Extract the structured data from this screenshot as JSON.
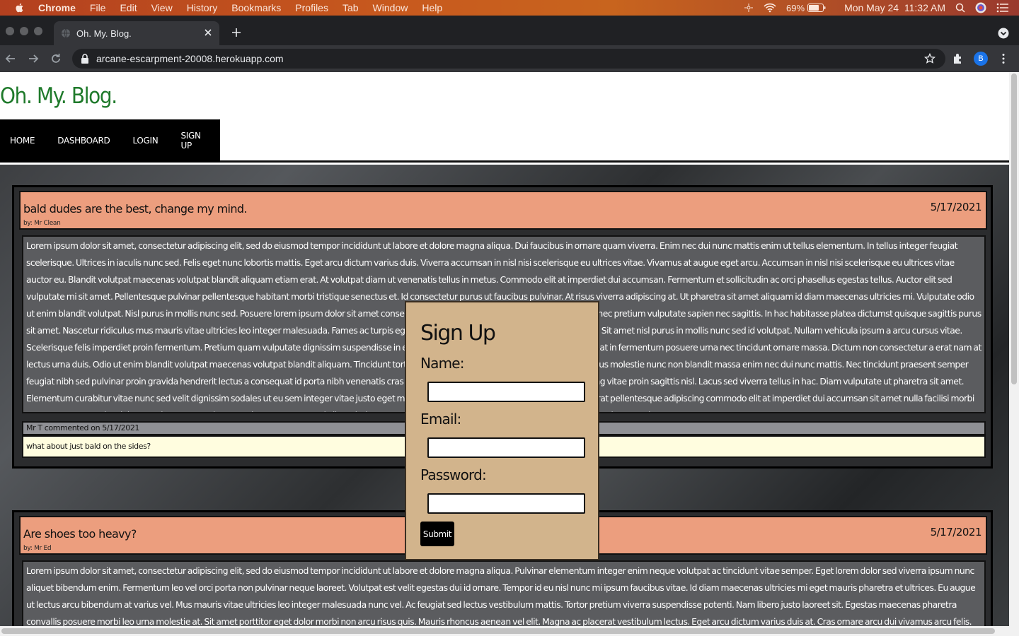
{
  "mac_menubar": {
    "app_name": "Chrome",
    "menus": [
      "File",
      "Edit",
      "View",
      "History",
      "Bookmarks",
      "Profiles",
      "Tab",
      "Window",
      "Help"
    ],
    "battery": "69%",
    "clock": "Mon May 24  11:32 AM"
  },
  "browser": {
    "tab_title": "Oh. My. Blog.",
    "url": "arcane-escarpment-20008.herokuapp.com",
    "profile_initial": "B"
  },
  "site": {
    "title": "Oh. My. Blog.",
    "nav": [
      "HOME",
      "DASHBOARD",
      "LOGIN",
      "SIGN UP"
    ]
  },
  "posts": [
    {
      "title": "bald dudes are the best, change my mind.",
      "author": "by: Mr Clean",
      "date": "5/17/2021",
      "body": "Lorem ipsum dolor sit amet, consectetur adipiscing elit, sed do eiusmod tempor incididunt ut labore et dolore magna aliqua. Dui faucibus in ornare quam viverra. Enim nec dui nunc mattis enim ut tellus elementum. In tellus integer feugiat scelerisque. Ultrices in iaculis nunc sed. Felis eget nunc lobortis mattis. Eget arcu dictum varius duis. Viverra accumsan in nisl nisi scelerisque eu ultrices vitae. Vivamus at augue eget arcu. Accumsan in nisl nisi scelerisque eu ultrices vitae auctor eu. Blandit volutpat maecenas volutpat blandit aliquam etiam erat. At volutpat diam ut venenatis tellus in metus. Commodo elit at imperdiet dui accumsan. Fermentum et sollicitudin ac orci phasellus egestas tellus. Auctor elit sed vulputate mi sit amet. Pellentesque pulvinar pellentesque habitant morbi tristique senectus et. Id consectetur purus ut faucibus pulvinar. At risus viverra adipiscing at. Ut pharetra sit amet aliquam id diam maecenas ultricies mi. Vulputate odio ut enim blandit volutpat. Nisl purus in mollis nunc sed. Posuere lorem ipsum dolor sit amet consectetur. Phasellus faucibus scelerisque eleifend donec pretium vulputate sapien nec sagittis. In hac habitasse platea dictumst quisque sagittis purus sit amet. Nascetur ridiculus mus mauris vitae ultricies leo integer malesuada. Fames ac turpis egestas integer eget aliquet nibh praesent tristique. Sit amet nisl purus in mollis nunc sed id volutpat. Nullam vehicula ipsum a arcu cursus vitae. Scelerisque felis imperdiet proin fermentum. Pretium quam vulputate dignissim suspendisse in est ante. Donec adipiscing tristique risus nec feugiat in fermentum posuere urna nec tincidunt ornare massa. Dictum non consectetur a erat nam at lectus urna duis. Odio ut enim blandit volutpat maecenas volutpat blandit aliquam. Tincidunt tortor aliquam nulla facilisi cras. Elementum nibh tellus molestie nunc non blandit massa enim nec dui nunc mattis. Nec tincidunt praesent semper feugiat nibh sed pulvinar proin gravida hendrerit lectus a consequat id porta nibh venenatis cras sed. Elementum nisi quis eleifend quam adipiscing vitae proin sagittis nisl. Lacus sed viverra tellus in hac. Diam vulputate ut pharetra sit amet. Elementum curabitur vitae nunc sed velit dignissim sodales ut eu sem integer vitae justo eget magna. Mauris cursus mattis molestie a iaculis at erat pellentesque adipiscing commodo elit at imperdiet dui accumsan sit amet nulla facilisi morbi tempus egestas sed sed risus pretium quam vulputate. Rhoncus aenean vel elit scelerisque mauris pellentesque pulvinar. Faucibus in ornare quam viverra orci.",
      "comments": [
        {
          "header": "Mr T commented on 5/17/2021",
          "text": "what about just bald on the sides?"
        }
      ]
    },
    {
      "title": "Are shoes too heavy?",
      "author": "by: Mr Ed",
      "date": "5/17/2021",
      "body": "Lorem ipsum dolor sit amet, consectetur adipiscing elit, sed do eiusmod tempor incididunt ut labore et dolore magna aliqua. Pulvinar elementum integer enim neque volutpat ac tincidunt vitae semper. Eget lorem dolor sed viverra ipsum nunc aliquet bibendum enim. Fermentum leo vel orci porta non pulvinar neque laoreet. Volutpat est velit egestas dui id ornare. Tempor id eu nisl nunc mi ipsum faucibus vitae. Id diam maecenas ultricies mi eget mauris pharetra et ultrices. Eu augue ut lectus arcu bibendum at varius vel. Mus mauris vitae ultricies leo integer malesuada nunc vel. Ac feugiat sed lectus vestibulum mattis. Tortor pretium viverra suspendisse potenti. Nam libero justo laoreet sit. Egestas maecenas pharetra convallis posuere morbi leo urna molestie at. Sit amet porttitor eget dolor morbi non arcu risus quis. Mauris rhoncus aenean vel elit. Magna ac placerat vestibulum lectus. Eget arcu dictum varius duis at. Cras ornare arcu dui vivamus arcu felis. Augue ut lectus arcu bibendum"
    }
  ],
  "signup_modal": {
    "heading": "Sign Up",
    "name_label": "Name:",
    "email_label": "Email:",
    "password_label": "Password:",
    "submit_label": "Submit",
    "name_value": "",
    "email_value": "",
    "password_value": ""
  }
}
